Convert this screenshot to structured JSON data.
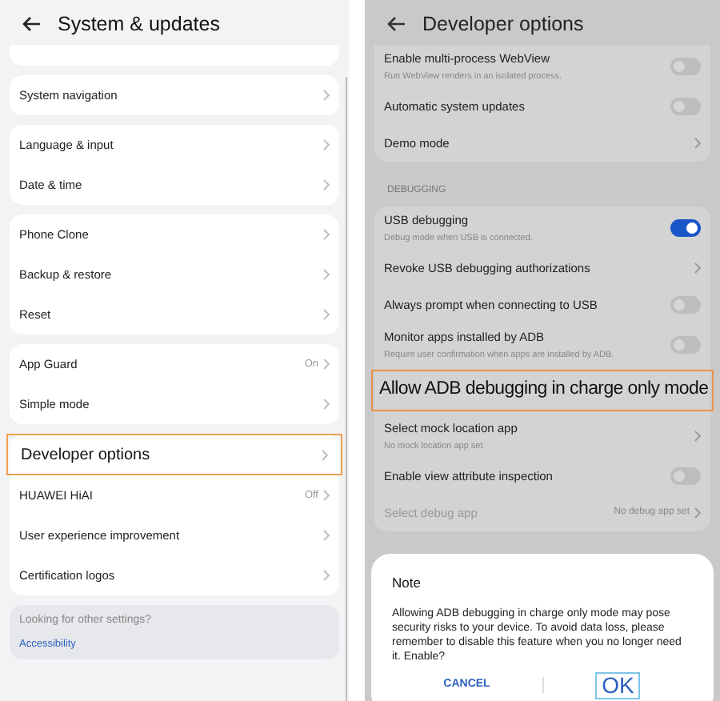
{
  "left": {
    "title": "System & updates",
    "cards": [
      {
        "rows": [
          {
            "label": "System navigation",
            "highlighted": false
          }
        ]
      },
      {
        "rows": [
          {
            "label": "Language & input",
            "highlighted": false
          },
          {
            "label": "Date & time",
            "highlighted": false
          }
        ]
      },
      {
        "rows": [
          {
            "label": "Phone Clone",
            "highlighted": false
          },
          {
            "label": "Backup & restore",
            "highlighted": false
          },
          {
            "label": "Reset",
            "highlighted": false
          }
        ]
      },
      {
        "rows": [
          {
            "label": "App Guard",
            "value": "On",
            "highlighted": false
          },
          {
            "label": "Simple mode",
            "highlighted": false
          }
        ]
      },
      {
        "rows": [
          {
            "label": "Developer options",
            "highlighted": true
          },
          {
            "label": "HUAWEI HiAI",
            "value": "Off",
            "highlighted": false
          },
          {
            "label": "User experience improvement",
            "highlighted": false
          },
          {
            "label": "Certification logos",
            "highlighted": false
          }
        ]
      }
    ],
    "footer": {
      "text": "Looking for other settings?",
      "link": "Accessibility"
    }
  },
  "right": {
    "title": "Developer options",
    "sections": [
      {
        "rows": [
          {
            "kind": "toggle",
            "label": "Enable multi-process WebView",
            "subtitle": "Run WebView renders in an isolated process.",
            "on": false
          },
          {
            "kind": "toggle",
            "label": "Automatic system updates",
            "on": false
          },
          {
            "kind": "chevron",
            "label": "Demo mode"
          }
        ]
      },
      {
        "header": "DEBUGGING",
        "rows": [
          {
            "kind": "toggle",
            "label": "USB debugging",
            "subtitle": "Debug mode when USB is connected.",
            "on": true
          },
          {
            "kind": "chevron",
            "label": "Revoke USB debugging authorizations"
          },
          {
            "kind": "toggle",
            "label": "Always prompt when connecting to USB",
            "on": false
          },
          {
            "kind": "toggle",
            "label": "Monitor apps installed by ADB",
            "subtitle": "Require user confirmation when apps are installed by ADB.",
            "on": false
          },
          {
            "kind": "highlight",
            "label": "Allow ADB debugging in charge only mode"
          },
          {
            "kind": "chevron",
            "label": "Select mock location app",
            "subtitle": "No mock location app set"
          },
          {
            "kind": "toggle",
            "label": "Enable view attribute inspection",
            "on": false
          },
          {
            "kind": "chevron",
            "label": "Select debug app",
            "value": "No debug app set",
            "disabled": true
          }
        ]
      }
    ],
    "dialog": {
      "title": "Note",
      "body": "Allowing ADB debugging in charge only mode may pose security risks to your device. To avoid data loss, please remember to disable this feature when you no longer need it. Enable?",
      "cancel": "CANCEL",
      "ok": "OK"
    }
  }
}
